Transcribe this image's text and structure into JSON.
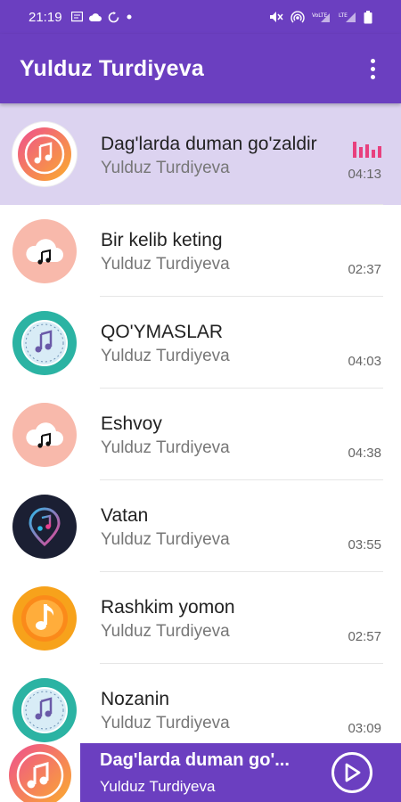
{
  "status_bar": {
    "time": "21:19",
    "left_icons": [
      "message-icon",
      "cloud-icon",
      "sync-icon",
      "dot-icon"
    ],
    "right_icons": [
      "mute-icon",
      "hotspot-icon",
      "lte-signal-icon",
      "signal-icon",
      "battery-icon"
    ]
  },
  "app_bar": {
    "title": "Yulduz Turdiyeva",
    "menu_icon": "more-vertical-icon"
  },
  "accent_colors": {
    "primary": "#6b3fc0",
    "active_row": "#dcd3f0",
    "equalizer": "#e8407e"
  },
  "songs": [
    {
      "title": "Dag'larda duman go'zaldir",
      "artist": "Yulduz Turdiyeva",
      "duration": "04:13",
      "playing": true,
      "icon": "music-note-orange-icon"
    },
    {
      "title": "Bir kelib keting",
      "artist": "Yulduz Turdiyeva",
      "duration": "02:37",
      "icon": "cloud-music-icon"
    },
    {
      "title": "QO'YMASLAR",
      "artist": "Yulduz Turdiyeva",
      "duration": "04:03",
      "icon": "music-note-teal-icon"
    },
    {
      "title": "Eshvoy",
      "artist": "Yulduz Turdiyeva",
      "duration": "04:38",
      "icon": "cloud-music-icon"
    },
    {
      "title": "Vatan",
      "artist": "Yulduz Turdiyeva",
      "duration": "03:55",
      "icon": "music-pin-dark-icon"
    },
    {
      "title": "Rashkim yomon",
      "artist": "Yulduz Turdiyeva",
      "duration": "02:57",
      "icon": "music-note-orange-icon"
    },
    {
      "title": "Nozanin",
      "artist": "Yulduz Turdiyeva",
      "duration": "03:09",
      "icon": "music-note-teal-icon"
    }
  ],
  "now_playing": {
    "title": "Dag'larda duman go'...",
    "artist": "Yulduz Turdiyeva",
    "play_icon": "play-icon"
  }
}
